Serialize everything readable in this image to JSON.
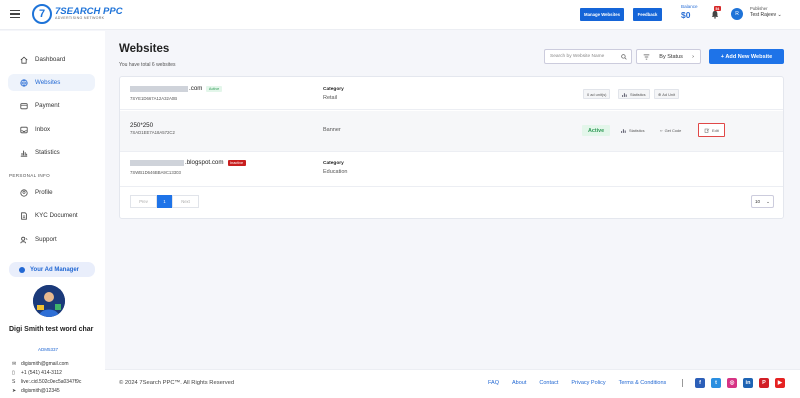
{
  "header": {
    "logo_mark": "7",
    "logo_name": "7SEARCH PPC",
    "logo_sub": "ADVERTISING NETWORK",
    "manage_websites_label": "Manage Websites",
    "feedback_label": "Feedback",
    "balance_label": "Balance",
    "balance_value": "$0",
    "notification_count": "54",
    "avatar_initial": "R",
    "user_role": "Publisher",
    "user_name": "Test Rajeev"
  },
  "sidebar": {
    "items": [
      {
        "label": "Dashboard",
        "icon": "home-icon"
      },
      {
        "label": "Websites",
        "icon": "globe-icon"
      },
      {
        "label": "Payment",
        "icon": "wallet-icon"
      },
      {
        "label": "Inbox",
        "icon": "inbox-icon"
      },
      {
        "label": "Statistics",
        "icon": "chart-icon"
      }
    ],
    "section_label": "PERSONAL INFO",
    "personal_items": [
      {
        "label": "Profile",
        "icon": "user-icon"
      },
      {
        "label": "KYC Document",
        "icon": "document-icon"
      },
      {
        "label": "Support",
        "icon": "support-icon"
      }
    ],
    "ad_manager_label": "Your Ad Manager",
    "manager_name": "Digi Smith test word char",
    "manager_id": "ADM5337",
    "contacts": [
      {
        "icon": "mail-icon",
        "text": "digismith@gmail.com"
      },
      {
        "icon": "phone-icon",
        "text": "+1 (541) 414-3112"
      },
      {
        "icon": "skype-icon",
        "text": "live:.cid.502c0ec5a0347f9c"
      },
      {
        "icon": "telegram-icon",
        "text": "digismith@12345"
      }
    ]
  },
  "main": {
    "title": "Websites",
    "subtitle": "You have total 6 websites",
    "search_placeholder": "Search by Website Name",
    "status_filter_label": "By Status",
    "add_button_label": "+ Add New Website",
    "rows": [
      {
        "name_suffix": ".com",
        "status": "Active",
        "id": "7SYE1D667A12A32A0B",
        "category_label": "Category",
        "category": "Retail",
        "actions": [
          "0 ad unit(s)",
          "Statistics",
          "Ad Unit"
        ]
      },
      {
        "name": "250*250",
        "id": "7SAD1EE7A18A572C2",
        "category": "Banner",
        "status": "Active",
        "actions": [
          "Statistics",
          "Get Code",
          "Edit"
        ]
      },
      {
        "name_suffix": ".blogspot.com",
        "status": "Inactive",
        "id": "7SWB1D646BBA9C13303",
        "category_label": "Category",
        "category": "Education"
      }
    ],
    "pager": {
      "prev": "Prev",
      "current": "1",
      "next": "Next",
      "per_page": "10"
    }
  },
  "footer": {
    "copyright": "© 2024 7Search PPC™. All Rights Reserved",
    "links": [
      "FAQ",
      "About",
      "Contact",
      "Privacy Policy",
      "Terms & Conditions"
    ],
    "social": [
      {
        "name": "facebook-icon",
        "glyph": "f",
        "color": "#2c5fb8"
      },
      {
        "name": "twitter-icon",
        "glyph": "t",
        "color": "#2b8fe0"
      },
      {
        "name": "instagram-icon",
        "glyph": "◎",
        "color": "#d63384"
      },
      {
        "name": "linkedin-icon",
        "glyph": "in",
        "color": "#1e64b4"
      },
      {
        "name": "pinterest-icon",
        "glyph": "P",
        "color": "#d21f26"
      },
      {
        "name": "youtube-icon",
        "glyph": "▶",
        "color": "#e52222"
      }
    ]
  }
}
